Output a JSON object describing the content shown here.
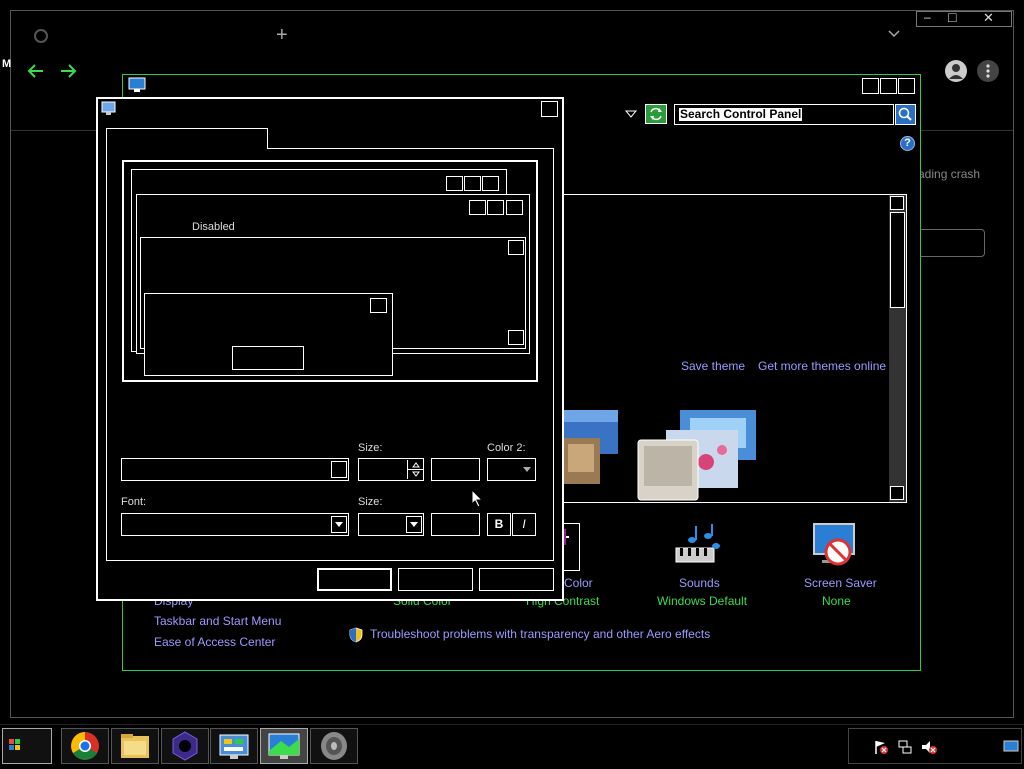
{
  "browser": {
    "new_tab_symbol": "+",
    "left_edge_char": "M",
    "window_controls": {
      "minimize": "–",
      "maximize": "□",
      "close": "✕"
    },
    "truncated_text": "ading crash"
  },
  "control_panel": {
    "search": {
      "value": "Search Control Panel"
    },
    "help_symbol": "?",
    "theme_links": {
      "save": "Save theme",
      "more": "Get more themes online"
    },
    "bottom_items": [
      {
        "title": "Color",
        "subtitle": "Solid Color"
      },
      {
        "title": "",
        "subtitle": "High Contrast"
      },
      {
        "title": "Sounds",
        "subtitle": "Windows Default"
      },
      {
        "title": "Screen Saver",
        "subtitle": "None"
      }
    ],
    "see_also": [
      "Display",
      "Taskbar and Start Menu",
      "Ease of Access Center"
    ],
    "troubleshoot_link": "Troubleshoot problems with transparency and other Aero effects"
  },
  "dialog": {
    "preview_label": "Disabled",
    "size_label_1": "Size:",
    "color2_label": "Color 2:",
    "font_label": "Font:",
    "size_label_2": "Size:",
    "bold_label": "B",
    "italic_label": "I"
  },
  "taskbar": {
    "apps": [
      "start",
      "chrome",
      "file-explorer",
      "app",
      "control-panel",
      "display",
      "sound"
    ]
  }
}
